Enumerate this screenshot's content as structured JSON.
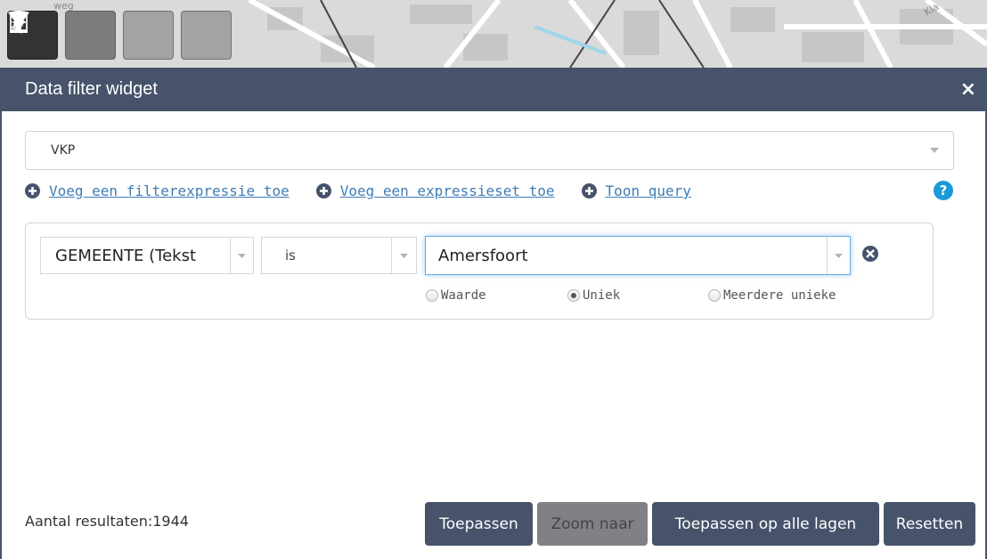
{
  "map": {
    "tools": [
      {
        "name": "filter-icon",
        "active": true
      },
      {
        "name": "download-icon",
        "active": false
      },
      {
        "name": "select-icon",
        "active": false
      },
      {
        "name": "grid-icon",
        "active": false
      }
    ],
    "labels": {
      "top_left": "weg",
      "top_right": "Kla"
    }
  },
  "widget": {
    "title": "Data filter widget",
    "close_icon": "×",
    "layer_select": {
      "value": "VKP"
    },
    "links": [
      {
        "label": "Voeg een filterexpressie toe",
        "icon": "plus-circle-icon"
      },
      {
        "label": "Voeg een expressieset toe",
        "icon": "plus-circle-icon"
      },
      {
        "label": "Toon query",
        "icon": "plus-circle-icon"
      }
    ],
    "help_icon": "?",
    "expression": {
      "field": "GEMEENTE (Tekst",
      "operator": "is",
      "value": "Amersfoort",
      "radio_options": [
        {
          "label": "Waarde",
          "checked": false
        },
        {
          "label": "Uniek",
          "checked": true
        },
        {
          "label": "Meerdere unieke",
          "checked": false
        }
      ]
    },
    "result_count": "Aantal resultaten:1944",
    "buttons": {
      "apply": "Toepassen",
      "zoom": "Zoom naar",
      "apply_all": "Toepassen op alle lagen",
      "reset": "Resetten"
    }
  },
  "colors": {
    "header": "#46536a",
    "link": "#3f7cb5",
    "focus_border": "#66afe9",
    "disabled_button": "#7f8185"
  }
}
